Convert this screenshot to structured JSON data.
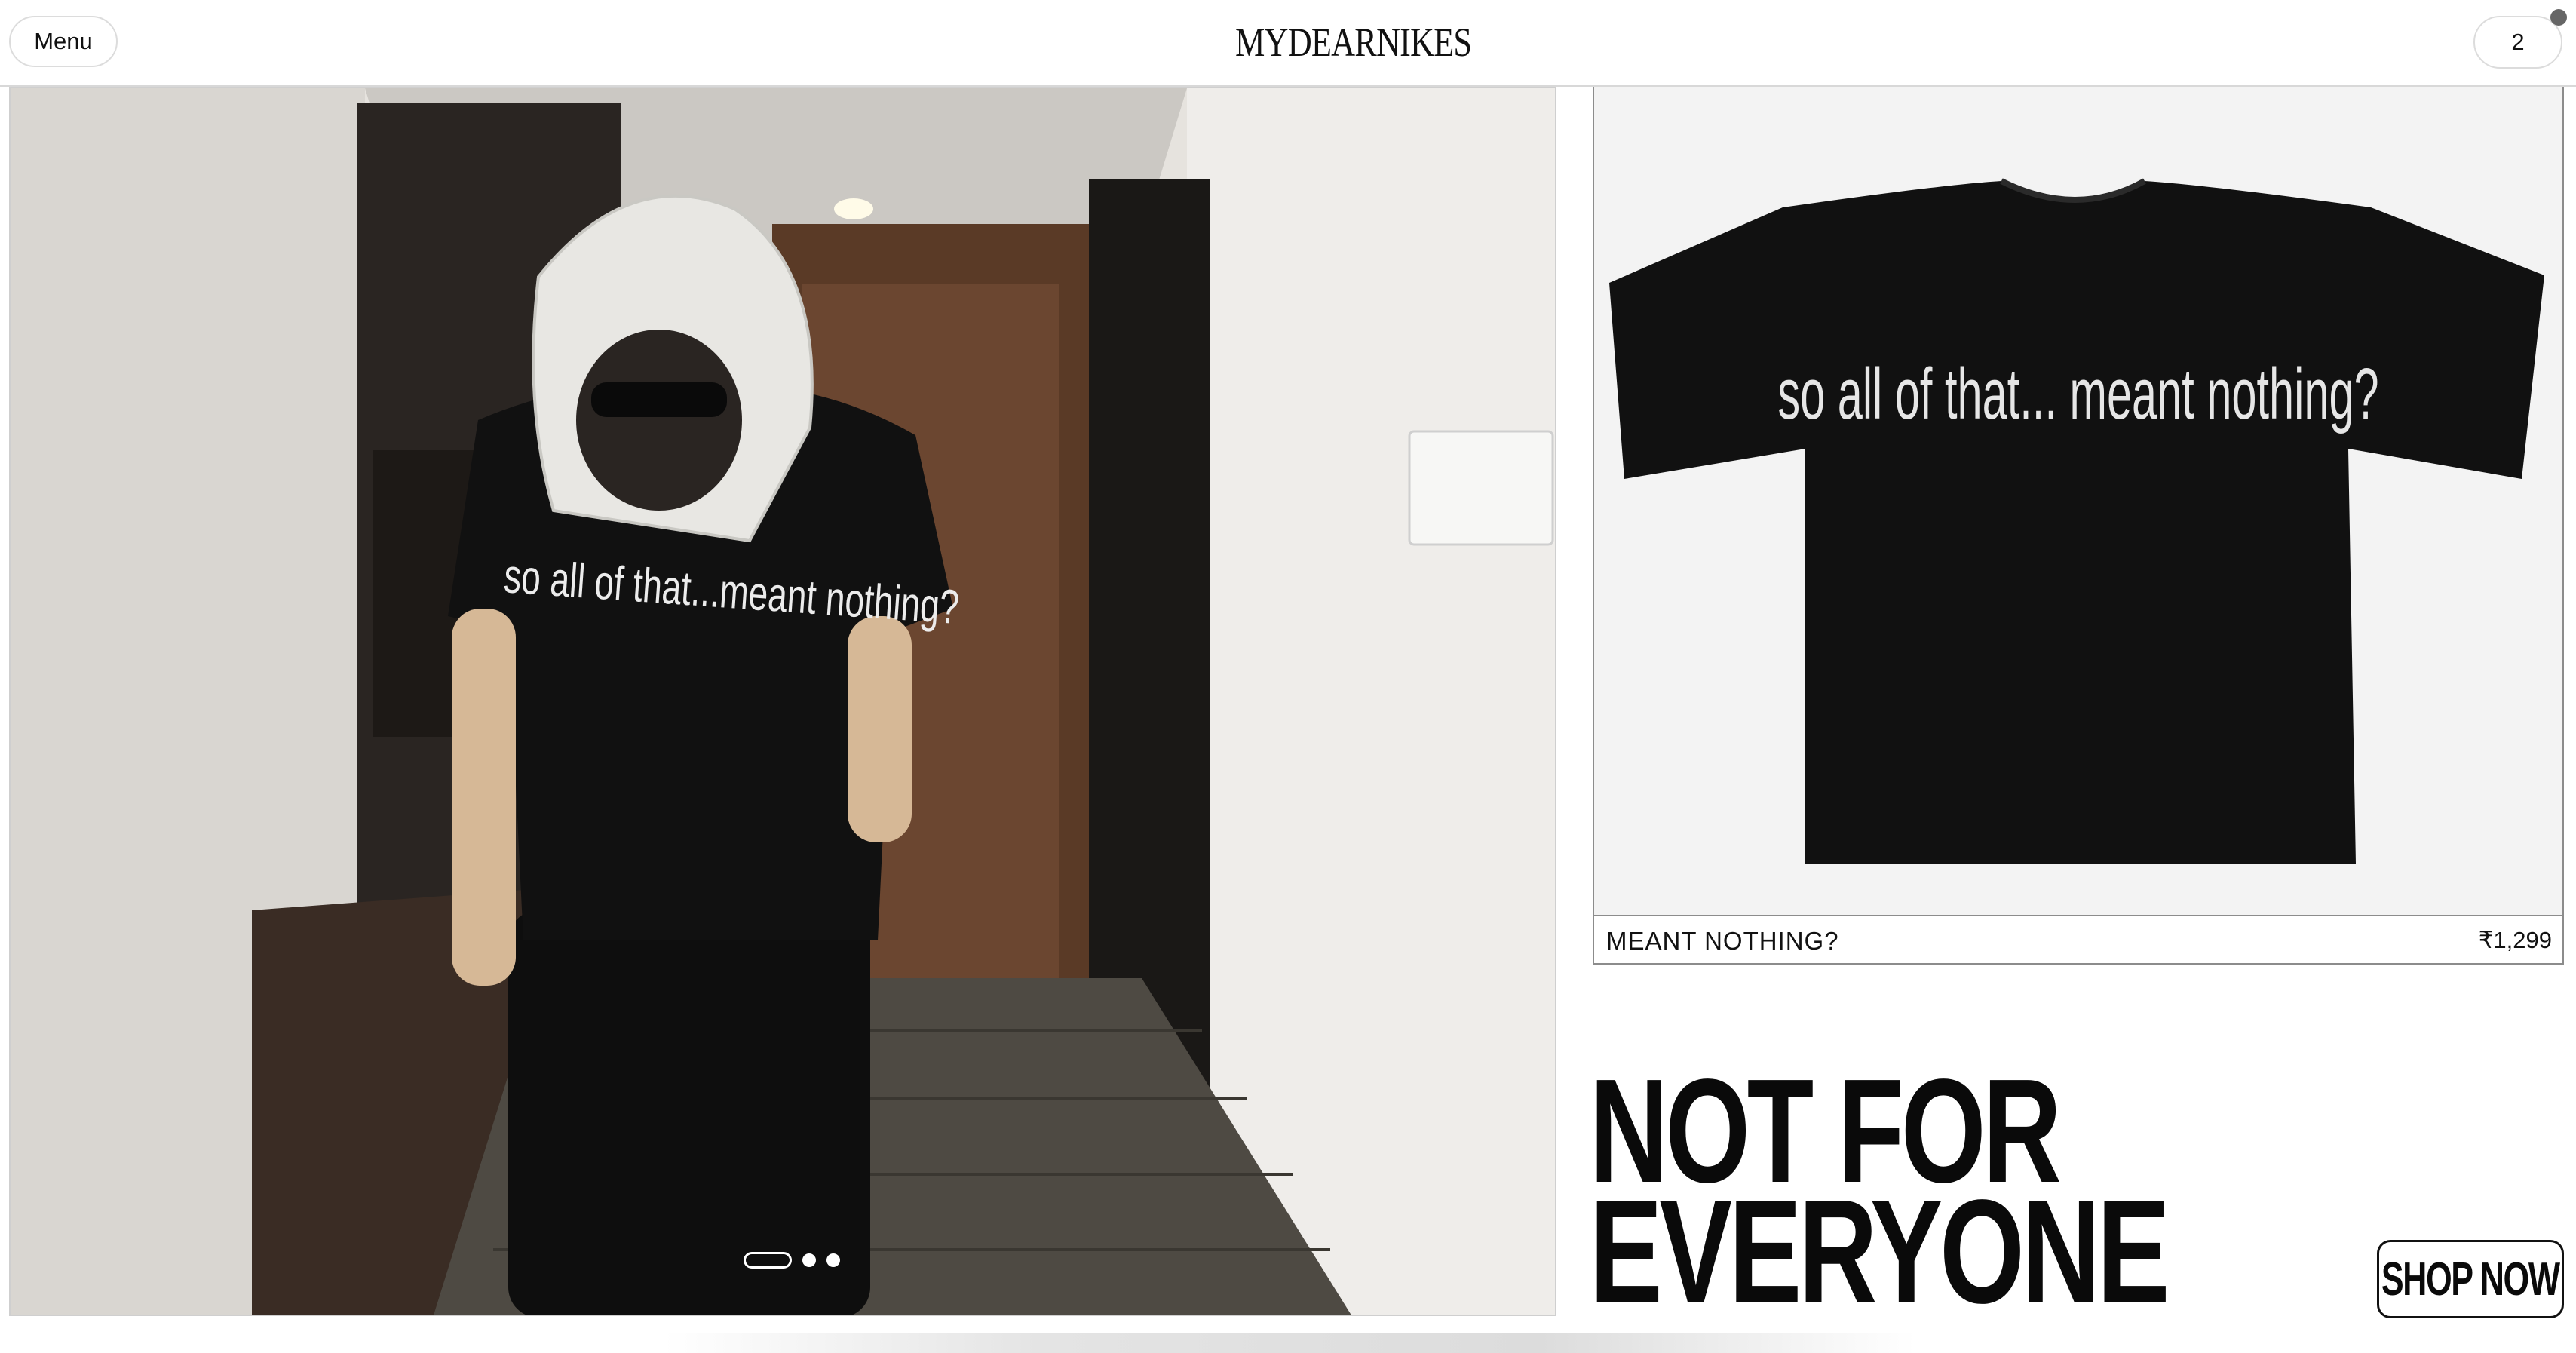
{
  "header": {
    "menu_label": "Menu",
    "logo_text": "MYDEARNIKES",
    "cart_count": "2"
  },
  "hero": {
    "shirt_print": "so all of that...meant nothing?",
    "carousel": {
      "total_slides": 3,
      "active_slide": 1
    }
  },
  "product": {
    "name": "MEANT NOTHING?",
    "price": "₹1,299",
    "shirt_print": "so all of that... meant nothing?"
  },
  "headline": {
    "line1": "NOT FOR",
    "line2": "EVERYONE"
  },
  "cta": {
    "shop_now_label": "SHOP NOW"
  },
  "colors": {
    "text": "#111111",
    "shirt": "#111111",
    "border": "#cfcfcf"
  },
  "icons": [
    "cart-badge-dot-icon",
    "carousel-dot-icon"
  ]
}
